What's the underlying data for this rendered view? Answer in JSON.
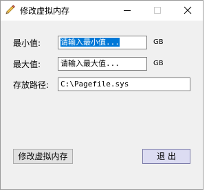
{
  "window": {
    "title": "修改虚拟内存"
  },
  "icons": {
    "app": "pencil-icon",
    "minimize": "minimize-icon",
    "maximize": "maximize-icon",
    "close": "close-icon"
  },
  "form": {
    "min_label": "最小值:",
    "min_value": "请输入最小值...",
    "min_unit": "GB",
    "max_label": "最大值:",
    "max_value": "请输入最大值...",
    "max_unit": "GB",
    "path_label": "存放路径:",
    "path_value": "C:\\Pagefile.sys"
  },
  "buttons": {
    "apply_label": "修改虚拟内存",
    "exit_label": "退 出"
  },
  "colors": {
    "selection": "#0078d7",
    "dialog_bg": "#f0f0f0"
  }
}
